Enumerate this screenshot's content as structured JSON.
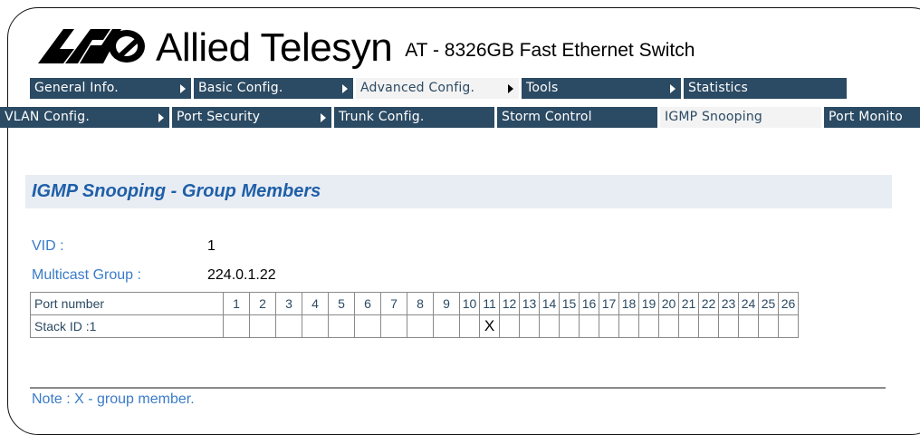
{
  "brand": {
    "name": "Allied Telesyn",
    "model": "AT - 8326GB Fast Ethernet Switch"
  },
  "colors": {
    "nav": "#2b4a63",
    "nav_text": "#ffffff",
    "active_tab_bg": "#f3f3f3",
    "heading": "#1f5fa8",
    "label": "#3a7bc8"
  },
  "menu": {
    "top": [
      {
        "label": "General Info.",
        "arrow": true
      },
      {
        "label": "Basic Config.",
        "arrow": true
      },
      {
        "label": "Advanced Config.",
        "arrow": true,
        "active": true
      },
      {
        "label": "Tools",
        "arrow": true
      },
      {
        "label": "Statistics",
        "arrow": false
      }
    ],
    "sub": [
      {
        "label": "VLAN Config.",
        "arrow": true
      },
      {
        "label": "Port Security",
        "arrow": true
      },
      {
        "label": "Trunk Config.",
        "arrow": false
      },
      {
        "label": "Storm Control",
        "arrow": false
      },
      {
        "label": "IGMP Snooping",
        "arrow": false,
        "active": true
      },
      {
        "label": "Port Monito",
        "arrow": false
      }
    ]
  },
  "page": {
    "title": "IGMP Snooping - Group Members",
    "vid_label": "VID :",
    "vid_value": "1",
    "group_label": "Multicast Group :",
    "group_value": "224.0.1.22"
  },
  "table": {
    "header_label": "Port number",
    "ports": [
      "1",
      "2",
      "3",
      "4",
      "5",
      "6",
      "7",
      "8",
      "9",
      "10",
      "11",
      "12",
      "13",
      "14",
      "15",
      "16",
      "17",
      "18",
      "19",
      "20",
      "21",
      "22",
      "23",
      "24",
      "25",
      "26"
    ],
    "rows": [
      {
        "label": "Stack ID :1",
        "cells": [
          "",
          "",
          "",
          "",
          "",
          "",
          "",
          "",
          "",
          "",
          "X",
          "",
          "",
          "",
          "",
          "",
          "",
          "",
          "",
          "",
          "",
          "",
          "",
          "",
          "",
          ""
        ]
      }
    ]
  },
  "note": "Note : X - group member."
}
